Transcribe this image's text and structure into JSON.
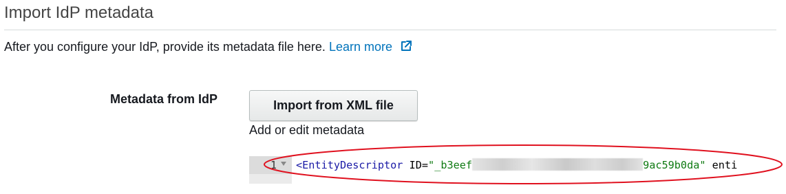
{
  "section": {
    "title": "Import IdP metadata",
    "description": "After you configure your IdP, provide its metadata file here.",
    "learn_more_label": "Learn more"
  },
  "form": {
    "metadata_label": "Metadata from IdP",
    "import_button_label": "Import from XML file",
    "helper_text": "Add or edit metadata"
  },
  "editor": {
    "line_number": "1",
    "tokens": {
      "tag": "<EntityDescriptor",
      "attr_id": " ID",
      "equals": "=",
      "value_start": "\"_b3eef",
      "value_end": "9ac59b0da\"",
      "attr_next": " enti"
    }
  },
  "icons": {
    "external_link": "external-link-icon",
    "fold": "chevron-down-icon"
  },
  "colors": {
    "link": "#0073bb",
    "annotation": "#e0101e",
    "xml_tag": "#1a1aa6",
    "xml_string": "#0f7a12"
  }
}
